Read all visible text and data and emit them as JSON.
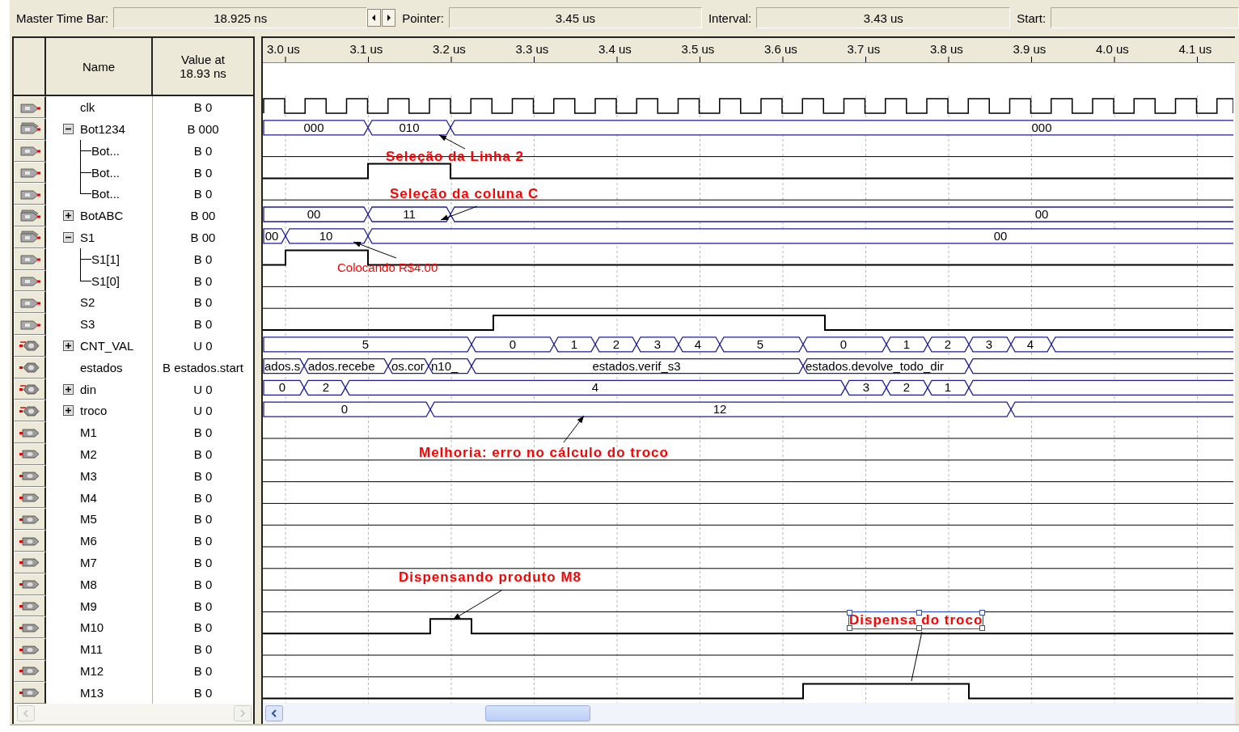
{
  "toolbar": {
    "master_time_bar": {
      "label": "Master Time Bar:",
      "value": "18.925 ns"
    },
    "pointer": {
      "label": "Pointer:",
      "value": "3.45 us"
    },
    "interval": {
      "label": "Interval:",
      "value": "3.43 us"
    },
    "start": {
      "label": "Start:"
    }
  },
  "columns": {
    "name": "Name",
    "value": "Value at 18.93 ns"
  },
  "ruler": [
    "3.0 us",
    "3.1 us",
    "3.2 us",
    "3.3 us",
    "3.4 us",
    "3.5 us",
    "3.6 us",
    "3.7 us",
    "3.8 us",
    "3.9 us",
    "4.0 us",
    "4.1 us"
  ],
  "signals": [
    {
      "name": "clk",
      "value": "B 0",
      "kind": "input"
    },
    {
      "name": "Bot1234",
      "value": "B 000",
      "kind": "input_group",
      "expanded": true,
      "wave_labels": [
        "000",
        "010",
        "000"
      ],
      "children": [
        {
          "name": "Bot...",
          "value": "B 0",
          "kind": "input"
        },
        {
          "name": "Bot...",
          "value": "B 0",
          "kind": "input"
        },
        {
          "name": "Bot...",
          "value": "B 0",
          "kind": "input"
        }
      ]
    },
    {
      "name": "BotABC",
      "value": "B 00",
      "kind": "input_group",
      "expanded": false,
      "wave_labels": [
        "00",
        "11",
        "00"
      ]
    },
    {
      "name": "S1",
      "value": "B 00",
      "kind": "input_group",
      "expanded": true,
      "wave_labels": [
        "00",
        "10",
        "00"
      ],
      "children": [
        {
          "name": "S1[1]",
          "value": "B 0",
          "kind": "input"
        },
        {
          "name": "S1[0]",
          "value": "B 0",
          "kind": "input"
        }
      ]
    },
    {
      "name": "S2",
      "value": "B 0",
      "kind": "input"
    },
    {
      "name": "S3",
      "value": "B 0",
      "kind": "input"
    },
    {
      "name": "CNT_VAL",
      "value": "U 0",
      "kind": "register_group",
      "expanded": false,
      "wave_labels": [
        "5",
        "0",
        "1",
        "2",
        "3",
        "4",
        "5",
        "0",
        "1",
        "2",
        "3",
        "4"
      ]
    },
    {
      "name": "estados",
      "value": "B estados.start",
      "kind": "state",
      "wave_labels": [
        "ados.s",
        "ados.recebe",
        "os.cor",
        "n10_",
        "estados.verif_s3",
        "estados.devolve_todo_dir"
      ]
    },
    {
      "name": "din",
      "value": "U 0",
      "kind": "register_group",
      "expanded": false,
      "wave_labels": [
        "0",
        "2",
        "4",
        "3",
        "2",
        "1"
      ]
    },
    {
      "name": "troco",
      "value": "U 0",
      "kind": "register_group",
      "expanded": false,
      "wave_labels": [
        "0",
        "12"
      ]
    },
    {
      "name": "M1",
      "value": "B 0",
      "kind": "output"
    },
    {
      "name": "M2",
      "value": "B 0",
      "kind": "output"
    },
    {
      "name": "M3",
      "value": "B 0",
      "kind": "output"
    },
    {
      "name": "M4",
      "value": "B 0",
      "kind": "output"
    },
    {
      "name": "M5",
      "value": "B 0",
      "kind": "output"
    },
    {
      "name": "M6",
      "value": "B 0",
      "kind": "output"
    },
    {
      "name": "M7",
      "value": "B 0",
      "kind": "output"
    },
    {
      "name": "M8",
      "value": "B 0",
      "kind": "output"
    },
    {
      "name": "M9",
      "value": "B 0",
      "kind": "output"
    },
    {
      "name": "M10",
      "value": "B 0",
      "kind": "output"
    },
    {
      "name": "M11",
      "value": "B 0",
      "kind": "output"
    },
    {
      "name": "M12",
      "value": "B 0",
      "kind": "output"
    },
    {
      "name": "M13",
      "value": "B 0",
      "kind": "output"
    }
  ],
  "annotations": [
    {
      "text": "Seleção da Linha 2",
      "selected": false
    },
    {
      "text": "Seleção da coluna C",
      "selected": false
    },
    {
      "text": "Colocando R$4.00",
      "selected": false
    },
    {
      "text": "Melhoria: erro no cálculo do troco",
      "selected": false
    },
    {
      "text": "Dispensando produto M8",
      "selected": false
    },
    {
      "text": "Dispensa do troco",
      "selected": true
    }
  ]
}
